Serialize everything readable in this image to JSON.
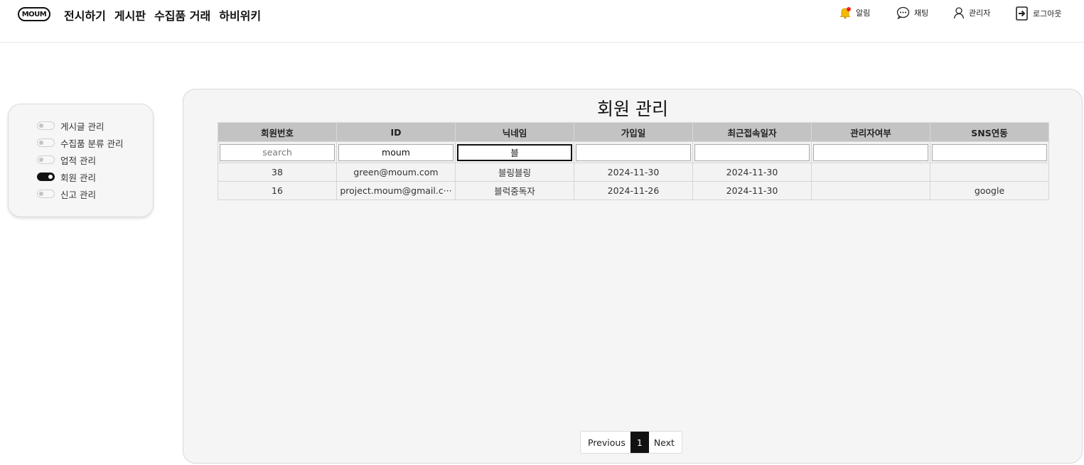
{
  "nav": {
    "logo": "MOUM",
    "menu": [
      "전시하기",
      "게시판",
      "수집품 거래",
      "하비위키"
    ],
    "alarm_label": "알림",
    "chat_label": "채팅",
    "admin_label": "관리자",
    "logout_label": "로그아웃",
    "alarm_icon": "bell-icon",
    "chat_icon": "chat-bubble-icon",
    "admin_icon": "user-icon",
    "logout_icon": "logout-icon",
    "accent_color": "#f5b800"
  },
  "sidebar": {
    "items": [
      {
        "label": "게시글 관리",
        "active": false
      },
      {
        "label": "수집품 분류 관리",
        "active": false
      },
      {
        "label": "업적 관리",
        "active": false
      },
      {
        "label": "회원 관리",
        "active": true
      },
      {
        "label": "신고 관리",
        "active": false
      }
    ]
  },
  "main": {
    "title": "회원 관리",
    "columns": [
      "회원번호",
      "ID",
      "닉네임",
      "가입일",
      "최근접속일자",
      "관리자여부",
      "SNS연동"
    ],
    "filters": {
      "member_no": {
        "value": "",
        "placeholder": "search"
      },
      "id": {
        "value": "moum",
        "placeholder": ""
      },
      "nickname": {
        "value": "블",
        "placeholder": ""
      },
      "join_date": {
        "value": "",
        "placeholder": ""
      },
      "last_login": {
        "value": "",
        "placeholder": ""
      },
      "is_admin": {
        "value": "",
        "placeholder": ""
      },
      "sns": {
        "value": "",
        "placeholder": ""
      }
    },
    "rows": [
      {
        "member_no": "38",
        "id": "green@moum.com",
        "nickname": "블링블링",
        "join_date": "2024-11-30",
        "last_login": "2024-11-30",
        "is_admin": "",
        "sns": ""
      },
      {
        "member_no": "16",
        "id": "project.moum@gmail.c···",
        "nickname": "블럭중독자",
        "join_date": "2024-11-26",
        "last_login": "2024-11-30",
        "is_admin": "",
        "sns": "google"
      }
    ],
    "pagination": {
      "previous": "Previous",
      "current": "1",
      "next": "Next"
    }
  }
}
